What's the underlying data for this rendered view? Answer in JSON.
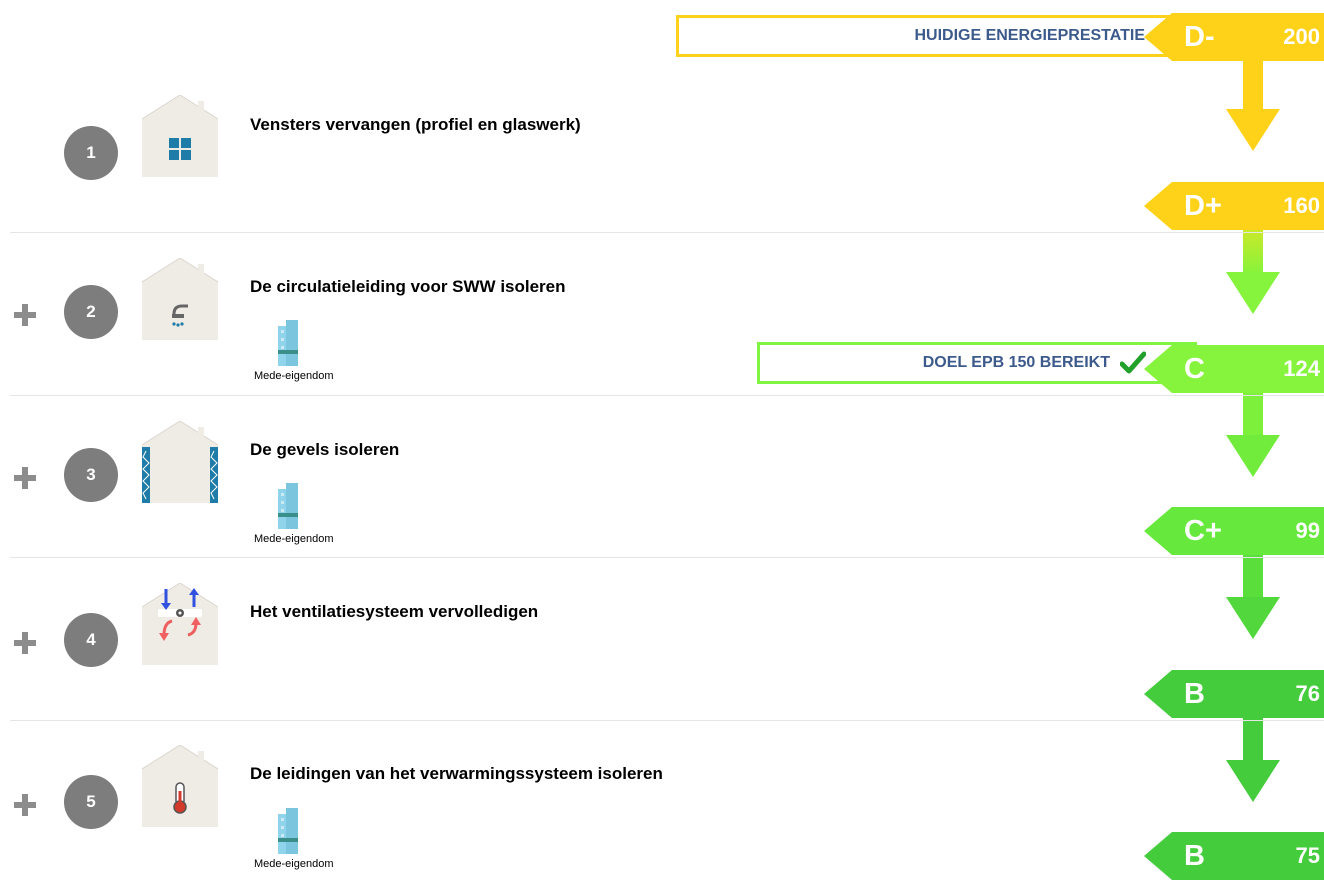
{
  "targets": {
    "current": {
      "label": "HUIDIGE ENERGIEPRESTATIE",
      "border_color": "#ffd21a"
    },
    "goal": {
      "label": "DOEL EPB 150 BEREIKT",
      "border_color": "#7ff542",
      "check_color": "#21a02a"
    }
  },
  "badges": [
    {
      "class": "D-",
      "value": "200",
      "color": "#ffd21a"
    },
    {
      "class": "D+",
      "value": "160",
      "color": "#ffd21a"
    },
    {
      "class": "C",
      "value": "124",
      "color": "#86f33c"
    },
    {
      "class": "C+",
      "value": "99",
      "color": "#66e83c"
    },
    {
      "class": "B",
      "value": "76",
      "color": "#44cc3d"
    },
    {
      "class": "B",
      "value": "75",
      "color": "#44cc3d"
    }
  ],
  "steps": [
    {
      "number": "1",
      "title": "Vensters vervangen (profiel en glaswerk)",
      "icon": "window-icon",
      "shared": false,
      "shared_label": ""
    },
    {
      "number": "2",
      "title": "De circulatieleiding voor SWW isoleren",
      "icon": "shower-icon",
      "shared": true,
      "shared_label": "Mede-eigendom"
    },
    {
      "number": "3",
      "title": "De gevels isoleren",
      "icon": "wall-insulation-icon",
      "shared": true,
      "shared_label": "Mede-eigendom"
    },
    {
      "number": "4",
      "title": "Het ventilatiesysteem vervolledigen",
      "icon": "ventilation-icon",
      "shared": false,
      "shared_label": ""
    },
    {
      "number": "5",
      "title": "De leidingen van het verwarmingssysteem isoleren",
      "icon": "thermometer-icon",
      "shared": true,
      "shared_label": "Mede-eigendom"
    }
  ]
}
